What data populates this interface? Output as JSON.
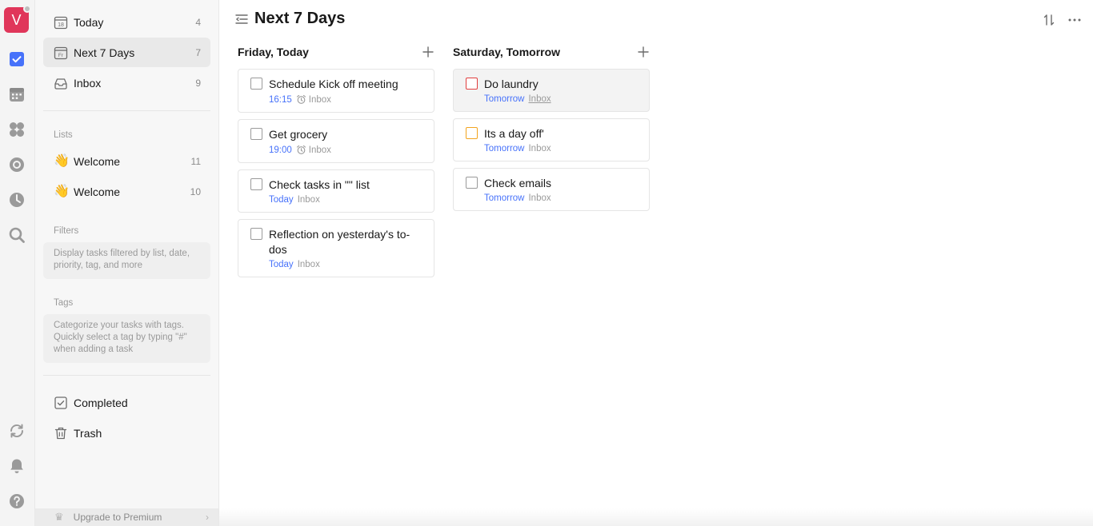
{
  "accent_color": "#4772fa",
  "rail": {
    "avatar_letter": "V",
    "icons": [
      "tasks-icon",
      "calendar-icon",
      "matrix-icon",
      "focus-icon",
      "habit-icon",
      "search-icon",
      "sync-icon",
      "notification-icon",
      "help-icon"
    ]
  },
  "sidebar": {
    "smart_lists": [
      {
        "label": "Today",
        "count": "4",
        "icon": "calendar-today-icon"
      },
      {
        "label": "Next 7 Days",
        "count": "7",
        "icon": "calendar-week-icon"
      },
      {
        "label": "Inbox",
        "count": "9",
        "icon": "inbox-icon"
      }
    ],
    "lists_heading": "Lists",
    "lists": [
      {
        "emoji": "👋",
        "label": "Welcome",
        "count": "11"
      },
      {
        "emoji": "👋",
        "label": "Welcome",
        "count": "10"
      }
    ],
    "filters_heading": "Filters",
    "filters_hint": "Display tasks filtered by list, date, priority, tag, and more",
    "tags_heading": "Tags",
    "tags_hint": "Categorize your tasks with tags. Quickly select a tag by typing \"#\" when adding a task",
    "completed_label": "Completed",
    "trash_label": "Trash",
    "upgrade_label": "Upgrade to Premium"
  },
  "main": {
    "title": "Next 7 Days",
    "columns": [
      {
        "title": "Friday, Today",
        "tasks": [
          {
            "title": "Schedule Kick off meeting",
            "date": "16:15",
            "alarm": true,
            "list": "Inbox",
            "priority_color": "#9a9a9a"
          },
          {
            "title": "Get grocery",
            "date": "19:00",
            "alarm": true,
            "list": "Inbox",
            "priority_color": "#9a9a9a"
          },
          {
            "title": "Check tasks in \"\" list",
            "date": "Today",
            "alarm": false,
            "list": "Inbox",
            "priority_color": "#9a9a9a"
          },
          {
            "title": "Reflection on yesterday's to-dos",
            "date": "Today",
            "alarm": false,
            "list": "Inbox",
            "priority_color": "#9a9a9a"
          }
        ]
      },
      {
        "title": "Saturday, Tomorrow",
        "tasks": [
          {
            "title": "Do laundry",
            "date": "Tomorrow",
            "alarm": false,
            "list": "Inbox",
            "priority_color": "#e03e3e",
            "selected": true
          },
          {
            "title": "Its a day off'",
            "date": "Tomorrow",
            "alarm": false,
            "list": "Inbox",
            "priority_color": "#f2a41e"
          },
          {
            "title": "Check emails",
            "date": "Tomorrow",
            "alarm": false,
            "list": "Inbox",
            "priority_color": "#9a9a9a"
          }
        ]
      }
    ]
  }
}
